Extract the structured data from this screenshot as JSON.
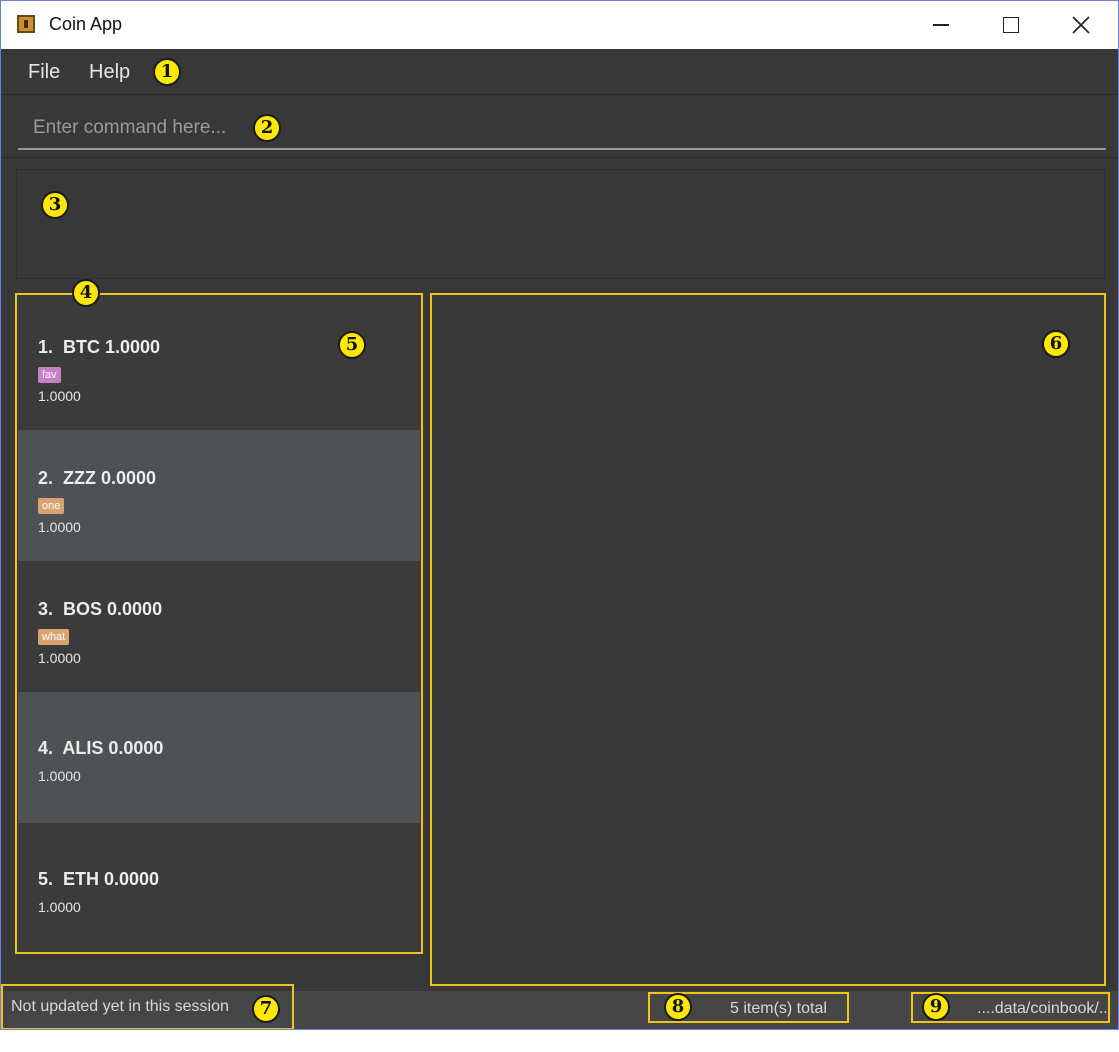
{
  "window": {
    "title": "Coin App"
  },
  "menu": {
    "file": "File",
    "help": "Help"
  },
  "command": {
    "placeholder": "Enter command here..."
  },
  "coins": [
    {
      "title": "1.  BTC 1.0000",
      "tag": "fav",
      "tag_color": "#c77fc5",
      "sub": "1.0000"
    },
    {
      "title": "2.  ZZZ 0.0000",
      "tag": "one",
      "tag_color": "#d9a26f",
      "sub": "1.0000"
    },
    {
      "title": "3.  BOS 0.0000",
      "tag": "what",
      "tag_color": "#d9a26f",
      "sub": "1.0000"
    },
    {
      "title": "4.  ALIS 0.0000",
      "tag": "",
      "sub": "1.0000"
    },
    {
      "title": "5.  ETH 0.0000",
      "tag": "",
      "sub": "1.0000"
    }
  ],
  "status": {
    "sync": "Not updated yet in this session",
    "count": "5 item(s) total",
    "path": "....data/coinbook/..."
  },
  "callouts": [
    "1",
    "2",
    "3",
    "4",
    "5",
    "6",
    "7",
    "8",
    "9"
  ],
  "colors": {
    "highlight": "#f0c419",
    "callout": "#ffe800",
    "background": "#383838"
  }
}
